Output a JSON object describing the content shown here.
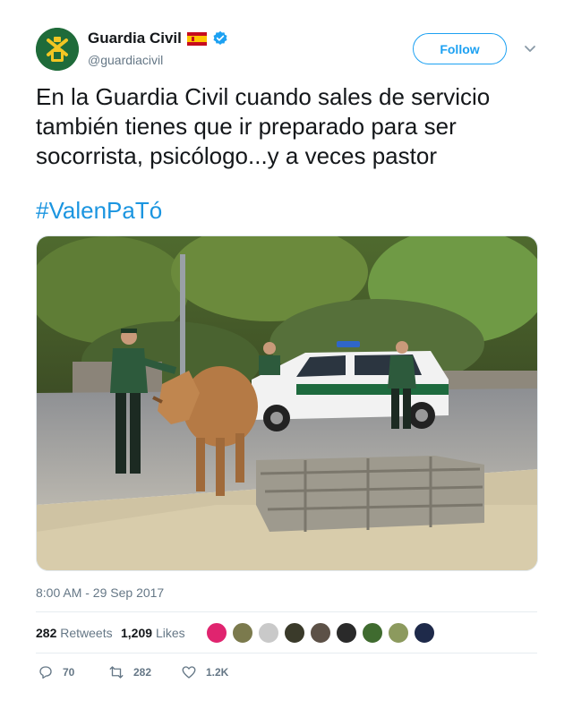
{
  "user": {
    "display_name": "Guardia Civil",
    "handle": "@guardiacivil",
    "avatar_icon": "guardia-civil-emblem",
    "flag_icon": "spain-flag-icon",
    "verified_icon": "verified-badge-icon"
  },
  "follow_label": "Follow",
  "tweet": {
    "text": "En la Guardia Civil cuando sales de servicio también tienes que ir preparado para ser socorrista, psicólogo...y a veces pastor",
    "hashtag": "#ValenPaTó",
    "timestamp": "8:00 AM - 29 Sep 2017"
  },
  "stats": {
    "retweets_count": "282",
    "retweets_label": "Retweets",
    "likes_count": "1,209",
    "likes_label": "Likes"
  },
  "actions": {
    "reply_count": "70",
    "retweet_count": "282",
    "like_count": "1.2K"
  },
  "colors": {
    "accent": "#1da1f2",
    "hashtag": "#1b95e0",
    "muted": "#657786"
  }
}
